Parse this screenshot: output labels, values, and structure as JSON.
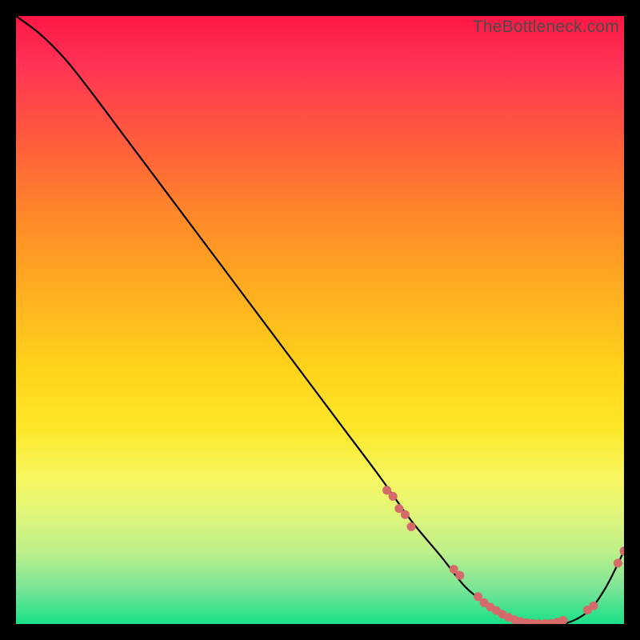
{
  "watermark": "TheBottleneck.com",
  "chart_data": {
    "type": "line",
    "title": "",
    "xlabel": "",
    "ylabel": "",
    "xlim": [
      0,
      100
    ],
    "ylim": [
      0,
      100
    ],
    "grid": false,
    "legend": false,
    "series": [
      {
        "name": "curve",
        "x": [
          0,
          4,
          8,
          12,
          18,
          24,
          30,
          36,
          42,
          48,
          54,
          60,
          65,
          70,
          74,
          78,
          82,
          86,
          90,
          94,
          97,
          100
        ],
        "y": [
          100,
          97,
          93,
          88,
          80,
          72,
          64,
          56,
          48,
          40,
          32,
          24,
          17,
          11,
          6,
          3,
          1,
          0,
          0,
          2,
          6,
          12
        ]
      }
    ],
    "points": [
      {
        "x": 61,
        "y": 22
      },
      {
        "x": 62,
        "y": 21
      },
      {
        "x": 63,
        "y": 19
      },
      {
        "x": 64,
        "y": 18
      },
      {
        "x": 65,
        "y": 16
      },
      {
        "x": 72,
        "y": 9
      },
      {
        "x": 73,
        "y": 8
      },
      {
        "x": 76,
        "y": 4.5
      },
      {
        "x": 77,
        "y": 3.5
      },
      {
        "x": 78,
        "y": 2.8
      },
      {
        "x": 79,
        "y": 2.2
      },
      {
        "x": 80,
        "y": 1.6
      },
      {
        "x": 81,
        "y": 1.1
      },
      {
        "x": 82,
        "y": 0.7
      },
      {
        "x": 83,
        "y": 0.4
      },
      {
        "x": 84,
        "y": 0.2
      },
      {
        "x": 85,
        "y": 0.1
      },
      {
        "x": 86,
        "y": 0.05
      },
      {
        "x": 87,
        "y": 0.05
      },
      {
        "x": 88,
        "y": 0.1
      },
      {
        "x": 89,
        "y": 0.3
      },
      {
        "x": 90,
        "y": 0.6
      },
      {
        "x": 94,
        "y": 2.3
      },
      {
        "x": 95,
        "y": 3.0
      },
      {
        "x": 99,
        "y": 10.0
      },
      {
        "x": 100,
        "y": 12.0
      }
    ],
    "gradient_colors": {
      "top": "#ff1744",
      "mid_high": "#ff8c28",
      "mid": "#ffd31a",
      "mid_low": "#f7f760",
      "bottom": "#18e088"
    }
  }
}
